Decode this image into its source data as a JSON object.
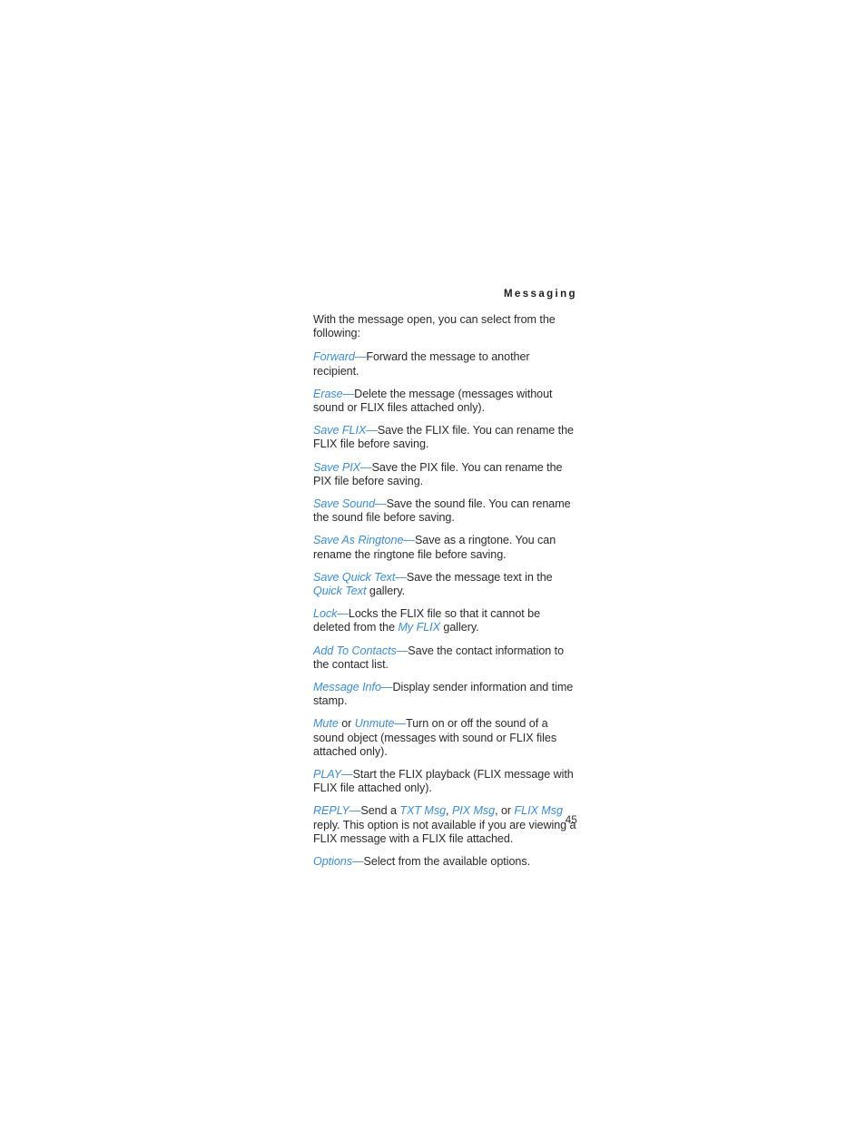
{
  "document": {
    "running_head": "Messaging",
    "page_number": "45",
    "accent_color": "#3b8ed6",
    "body_color": "#2b2b2b",
    "background_color": "#ffffff"
  },
  "body": {
    "intro": "With the message open, you can select from the following:",
    "entries": [
      {
        "term": "Forward",
        "dash": "—",
        "description": "Forward the message to another recipient."
      },
      {
        "term": "Erase",
        "dash": "—",
        "description": "Delete the message (messages without sound or FLIX files attached only)."
      },
      {
        "term": "Save FLIX",
        "dash": "—",
        "description": "Save the FLIX file. You can rename the FLIX file before saving."
      },
      {
        "term": "Save PIX",
        "dash": "—",
        "description": "Save the PIX file. You can rename the PIX file before saving."
      },
      {
        "term": "Save Sound",
        "dash": "—",
        "description": "Save the sound file. You can rename the sound file before saving."
      },
      {
        "term": "Save As Ringtone",
        "dash": "—",
        "description": "Save as a ringtone. You can rename the ringtone file before saving."
      },
      {
        "term": "Save Quick Text",
        "dash": "—",
        "description_before": "Save the message text in the ",
        "inline_term": "Quick Text",
        "description_after": " gallery."
      },
      {
        "term": "Lock",
        "dash": "—",
        "description_before": "Locks the FLIX file so that it cannot be deleted from the ",
        "inline_term": "My FLIX",
        "description_after": " gallery."
      },
      {
        "term": "Add To Contacts",
        "dash": "—",
        "description": "Save the contact information to the contact list."
      },
      {
        "term": "Message Info",
        "dash": "—",
        "description": "Display sender information and time stamp."
      },
      {
        "term": "Mute",
        "term_joiner": " or ",
        "term2": "Unmute",
        "dash": "—",
        "description": "Turn on or off the sound of a sound object (messages with sound or FLIX files attached only)."
      },
      {
        "term": "PLAY",
        "dash": "—",
        "description": "Start the FLIX playback (FLIX message with FLIX file attached only)."
      },
      {
        "term": "REPLY",
        "dash": "—",
        "reply_before": "Send a ",
        "reply_term1": "TXT Msg",
        "reply_sep1": ", ",
        "reply_term2": "PIX Msg",
        "reply_sep2": ", or ",
        "reply_term3": "FLIX Msg",
        "reply_after": " reply. This option is not available if you are viewing a FLIX message with a FLIX file attached."
      },
      {
        "term": "Options",
        "dash": "—",
        "description": "Select from the available options."
      }
    ]
  }
}
